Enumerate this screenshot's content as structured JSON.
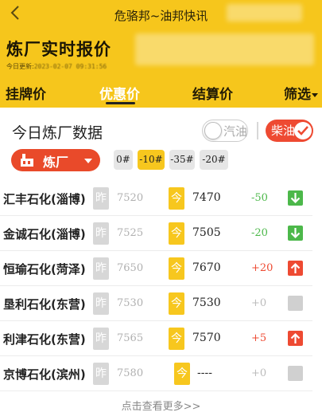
{
  "header": {
    "back_icon": "chevron-left-icon",
    "title": "危骆邦~油邦快讯",
    "main_title": "炼厂实时报价",
    "update_label": "今日更新:",
    "update_time": "2023-02-07 09:31:56",
    "background_color": "#f6c61c"
  },
  "tabs": [
    {
      "label": "挂牌价"
    },
    {
      "label": "优惠价"
    },
    {
      "label": "结算价"
    },
    {
      "label": "筛选"
    }
  ],
  "section": {
    "title": "今日炼厂数据",
    "gasoline_label": "汽油",
    "diesel_label": "柴油",
    "diesel_selected": true,
    "refinery_button": "炼厂",
    "refinery_icon": "factory-icon",
    "accent_color": "#e94a2a"
  },
  "grades": [
    {
      "label": "0#",
      "active": false
    },
    {
      "label": "-10#",
      "active": true
    },
    {
      "label": "-35#",
      "active": false
    },
    {
      "label": "-20#",
      "active": false
    }
  ],
  "rows": [
    {
      "name": "汇丰石化(淄博)",
      "yesterday_label": "昨",
      "yesterday_price": "7520",
      "today_label": "今",
      "today_price": "7470",
      "change": "-50",
      "trend": "down"
    },
    {
      "name": "金诚石化(淄博)",
      "yesterday_label": "昨",
      "yesterday_price": "7525",
      "today_label": "今",
      "today_price": "7505",
      "change": "-20",
      "trend": "down"
    },
    {
      "name": "恒瑜石化(菏泽)",
      "yesterday_label": "昨",
      "yesterday_price": "7650",
      "today_label": "今",
      "today_price": "7670",
      "change": "+20",
      "trend": "up"
    },
    {
      "name": "垦利石化(东营)",
      "yesterday_label": "昨",
      "yesterday_price": "7530",
      "today_label": "今",
      "today_price": "7530",
      "change": "+0",
      "trend": "flat"
    },
    {
      "name": "利津石化(东营)",
      "yesterday_label": "昨",
      "yesterday_price": "7565",
      "today_label": "今",
      "today_price": "7570",
      "change": "+5",
      "trend": "up"
    },
    {
      "name": "京博石化(滨州)",
      "yesterday_label": "昨",
      "yesterday_price": "7580",
      "today_label": "今",
      "today_price": "----",
      "change": "+0",
      "trend": "flat"
    }
  ],
  "colors": {
    "down": "#4cb84a",
    "up": "#ee4a32",
    "flat": "#d0d0d0"
  },
  "footer": {
    "more_link": "点击查看更多>>"
  }
}
